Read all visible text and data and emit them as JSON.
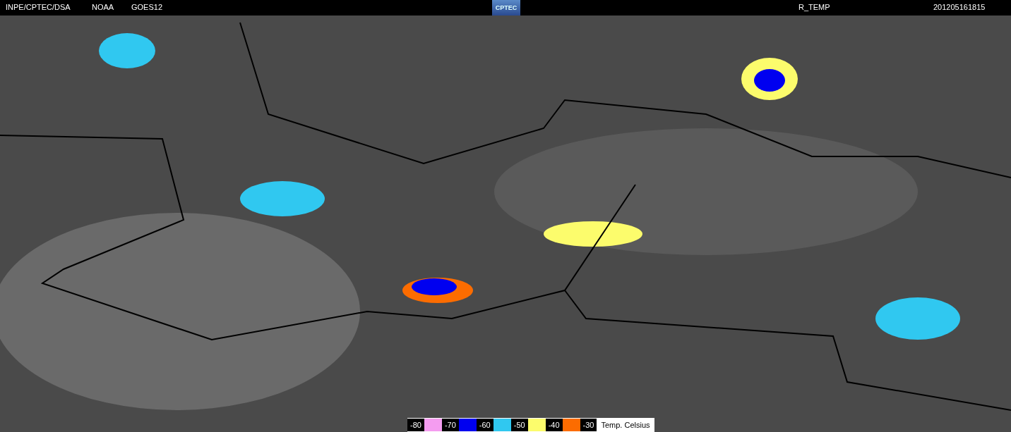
{
  "header": {
    "source": "INPE/CPTEC/DSA",
    "agency": "NOAA",
    "satellite": "GOES12",
    "logo": "CPTEC",
    "product": "R_TEMP",
    "timestamp": "201205161815"
  },
  "legend": {
    "items": [
      {
        "label": "-80",
        "color": "#f49cf0"
      },
      {
        "label": "-70",
        "color": "#0000f0"
      },
      {
        "label": "-60",
        "color": "#30c8f0"
      },
      {
        "label": "-50",
        "color": "#fcfc6c"
      },
      {
        "label": "-40",
        "color": "#fc6c00"
      },
      {
        "label": "-30"
      }
    ],
    "unit": "Temp. Celsius"
  }
}
